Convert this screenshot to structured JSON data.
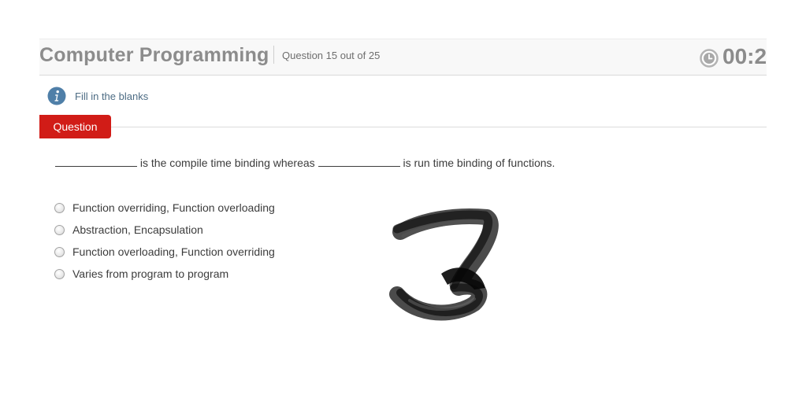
{
  "header": {
    "course_title": "Computer Programming",
    "question_count": "Question 15 out of 25",
    "timer": "00:2"
  },
  "info": {
    "text": "Fill in the blanks"
  },
  "question": {
    "tab_label": "Question",
    "part1": "is the compile time binding whereas",
    "part2": "is run time binding of functions."
  },
  "options": [
    {
      "label": "Function overriding, Function overloading",
      "selected": false
    },
    {
      "label": "Abstraction, Encapsulation",
      "selected": false
    },
    {
      "label": "Function overloading, Function overriding",
      "selected": false
    },
    {
      "label": "Varies from program to program",
      "selected": false
    }
  ],
  "colors": {
    "accent_red": "#d11c17",
    "info_blue": "#4f7fa8",
    "header_text": "#8c8c8c"
  },
  "annotation": {
    "handwritten_mark": "3"
  }
}
